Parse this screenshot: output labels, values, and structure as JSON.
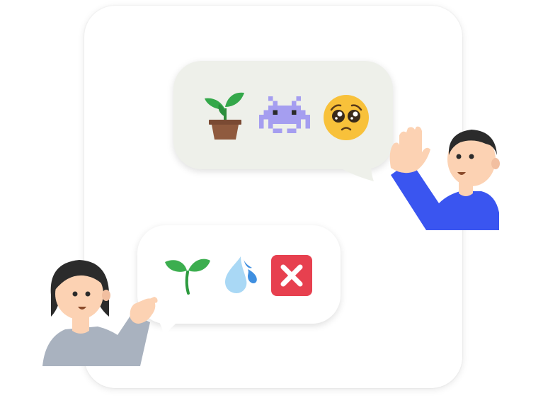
{
  "scene": {
    "colors": {
      "card_bg": "#ffffff",
      "bubble_top_bg": "#eef0ea",
      "bubble_bottom_bg": "#ffffff",
      "accent_blue": "#3a55f0",
      "shirt_gray": "#a9b2bf",
      "skin": "#fcd2b3",
      "hair": "#2b2b2b",
      "red": "#e7404f"
    },
    "top_message": {
      "sender": "man-right",
      "emojis": [
        "potted-plant-icon",
        "space-invader-icon",
        "pleading-face-icon"
      ]
    },
    "bottom_message": {
      "sender": "woman-left",
      "emojis": [
        "seedling-icon",
        "sweat-droplets-icon",
        "cross-mark-icon"
      ]
    }
  }
}
